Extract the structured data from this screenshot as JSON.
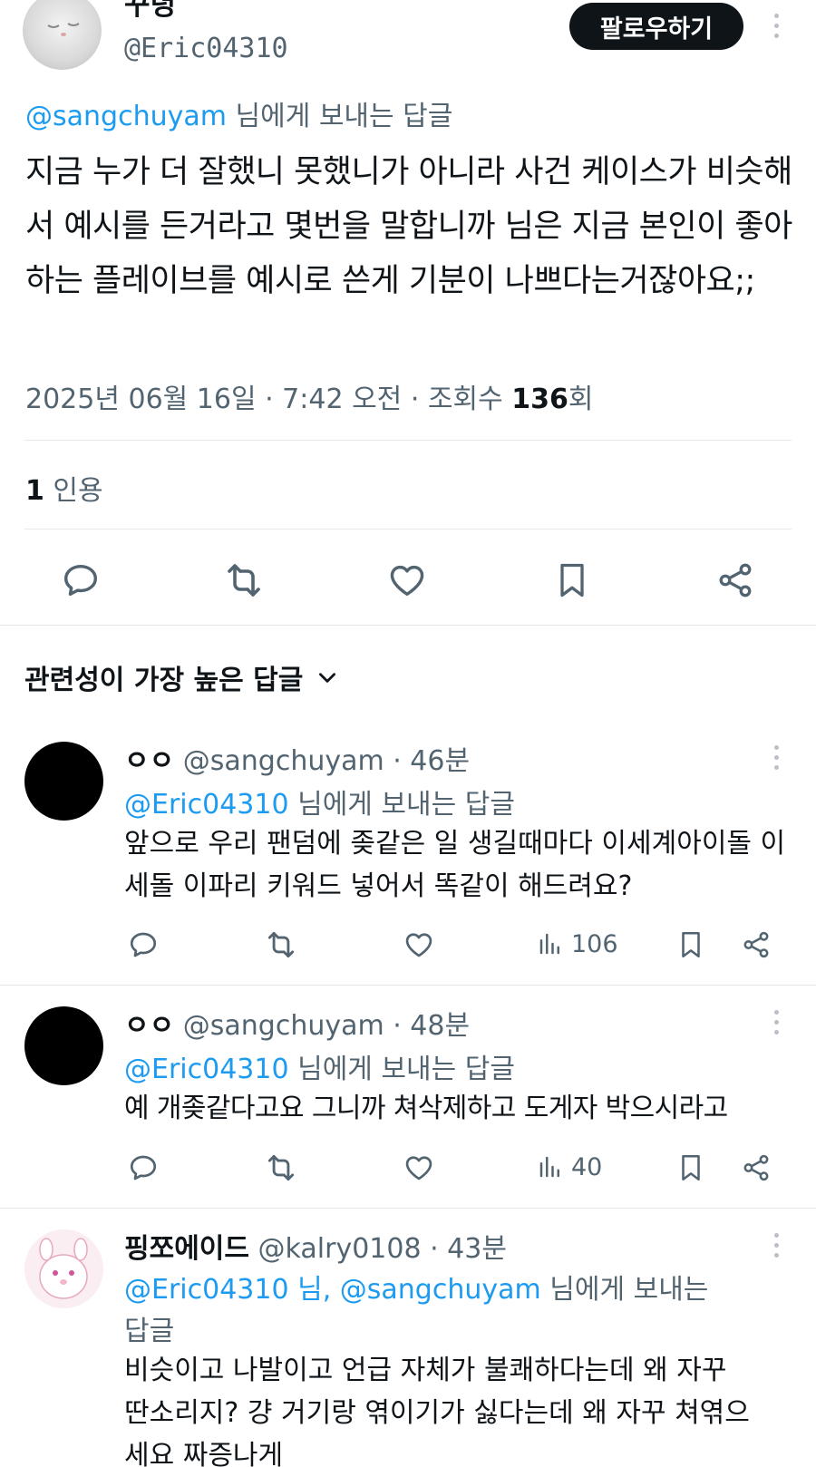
{
  "tweet": {
    "author_name": "꾸녕",
    "author_handle": "@Eric04310",
    "follow_label": "팔로우하기",
    "reply_to_handle": "@sangchuyam",
    "reply_to_suffix": " 님에게 보내는 답글",
    "text": "지금 누가 더 잘했니 못했니가 아니라 사건 케이스가 비슷해서 예시를 든거라고 몇번을 말합니까 님은 지금 본인이 좋아하는 플레이브를 예시로 쓴게 기분이 나쁘다는거잖아요;;",
    "date_text": "2025년 06월 16일 · 7:42 오전 · 조회수 ",
    "views_count": "136",
    "views_suffix": "회",
    "quote_count": "1",
    "quote_label": " 인용"
  },
  "actions": [
    "reply-icon",
    "retweet-icon",
    "like-icon",
    "bookmark-icon",
    "share-icon"
  ],
  "replies_header": {
    "label": "관련성이 가장 높은 답글"
  },
  "replies": [
    {
      "name": "ㅇㅇ",
      "handle": "@sangchuyam",
      "time": " · 46분",
      "to_handle": "@Eric04310",
      "to_suffix": " 님에게 보내는 답글",
      "text": "앞으로 우리 팬덤에 좆같은 일 생길때마다 이세계아이돌 이세돌 이파리 키워드 넣어서 똑같이 해드려요?",
      "views": "106"
    },
    {
      "name": "ㅇㅇ",
      "handle": "@sangchuyam",
      "time": " · 48분",
      "to_handle": "@Eric04310",
      "to_suffix": " 님에게 보내는 답글",
      "text": "예 개좆같다고요 그니까 쳐삭제하고 도게자 박으시라고",
      "views": "40"
    },
    {
      "name": "핑쪼에이드",
      "handle": "@kalry0108",
      "time": " · 43분",
      "to_handle": "@Eric04310 님, @sangchuyam",
      "to_suffix": " 님에게 보내는",
      "to_suffix_2": "답글",
      "text": "비슷이고 나발이고 언급 자체가 불쾌하다는데 왜 자꾸 딴소리지? 걍 거기랑 엮이기가 싫다는데 왜 자꾸 쳐엮으세요 짜증나게"
    }
  ],
  "colors": {
    "link": "#1d9bf0",
    "secondary_text": "#536471",
    "divider": "#e6e9eb",
    "follow_button_bg": "#0f1419"
  }
}
